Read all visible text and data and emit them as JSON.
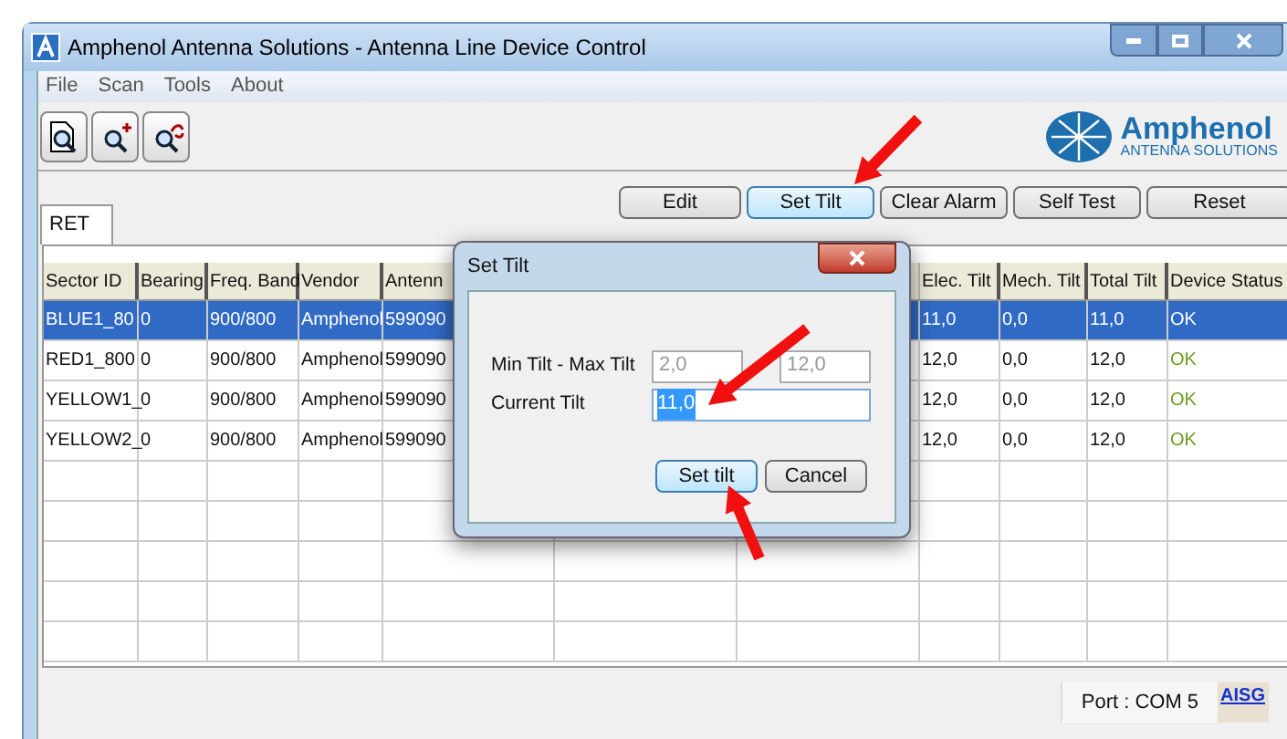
{
  "window": {
    "title": "Amphenol Antenna Solutions - Antenna Line Device Control"
  },
  "menu": [
    "File",
    "Scan",
    "Tools",
    "About"
  ],
  "logo": {
    "name": "Amphenol",
    "tagline": "ANTENNA SOLUTIONS"
  },
  "actions": [
    {
      "label": "Edit",
      "selected": false
    },
    {
      "label": "Set Tilt",
      "selected": true
    },
    {
      "label": "Clear Alarm",
      "selected": false
    },
    {
      "label": "Self Test",
      "selected": false
    },
    {
      "label": "Reset",
      "selected": false
    }
  ],
  "tabs": [
    {
      "label": "RET",
      "selected": true
    }
  ],
  "table": {
    "columns": [
      "Sector ID",
      "Bearing",
      "Freq. Band",
      "Vendor",
      "Antenn",
      "Elec. Tilt",
      "Mech. Tilt",
      "Total Tilt",
      "Device Status"
    ],
    "rows": [
      {
        "selected": true,
        "cells": [
          "BLUE1_80",
          "0",
          "900/800",
          "Amphenol",
          "599090",
          "11,0",
          "0,0",
          "11,0",
          "OK"
        ]
      },
      {
        "selected": false,
        "cells": [
          "RED1_800",
          "0",
          "900/800",
          "Amphenol",
          "599090",
          "12,0",
          "0,0",
          "12,0",
          "OK"
        ]
      },
      {
        "selected": false,
        "cells": [
          "YELLOW1_",
          "0",
          "900/800",
          "Amphenol",
          "599090",
          "12,0",
          "0,0",
          "12,0",
          "OK"
        ]
      },
      {
        "selected": false,
        "cells": [
          "YELLOW2_",
          "0",
          "900/800",
          "Amphenol",
          "599090",
          "12,0",
          "0,0",
          "12,0",
          "OK"
        ]
      }
    ]
  },
  "dialog": {
    "title": "Set Tilt",
    "range_label": "Min Tilt - Max Tilt",
    "min": "2,0",
    "max": "12,0",
    "current_label": "Current Tilt",
    "current": "11,0",
    "buttons": [
      {
        "label": "Set tilt",
        "selected": true
      },
      {
        "label": "Cancel",
        "selected": false
      }
    ]
  },
  "status_bar": {
    "port": "Port : COM  5",
    "badge": "AISG"
  }
}
